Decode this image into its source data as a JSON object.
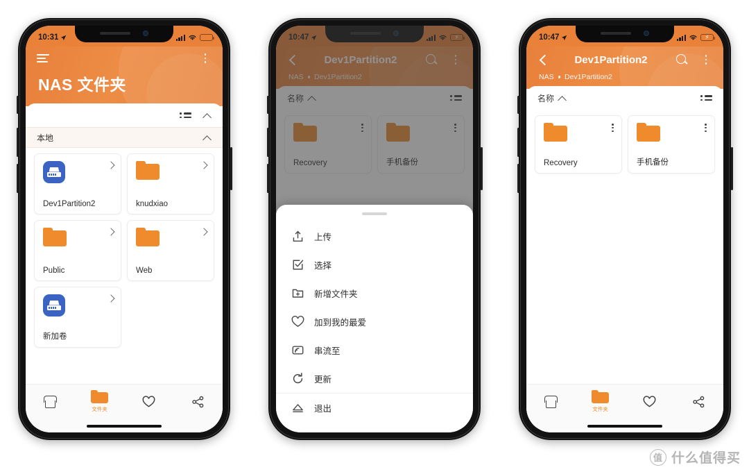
{
  "phones": [
    {
      "id": "phone-overview",
      "status": {
        "time": "10:31",
        "location_icon": "location-arrow-icon",
        "signal": "signal-bars-icon",
        "wifi": "wifi-icon",
        "battery": "battery-low-icon",
        "battery_color": "#f05a41",
        "charging": false
      },
      "header": {
        "style": "title",
        "menu_icon": "hamburger-menu-icon",
        "overflow_icon": "kebab-menu-icon",
        "title": "NAS 文件夹"
      },
      "toolbar": {
        "list_view_icon": "list-view-icon",
        "collapse_icon": "chevron-up-icon"
      },
      "group": {
        "label": "本地",
        "collapse_icon": "chevron-up-icon"
      },
      "cards": [
        {
          "name": "Dev1Partition2",
          "icon": "nas-drive-icon",
          "accessory": "chevron-right-icon"
        },
        {
          "name": "knudxiao",
          "icon": "folder-icon",
          "accessory": "chevron-right-icon"
        },
        {
          "name": "Public",
          "icon": "folder-icon",
          "accessory": "chevron-right-icon"
        },
        {
          "name": "Web",
          "icon": "folder-icon",
          "accessory": "chevron-right-icon"
        },
        {
          "name": "新加卷",
          "icon": "nas-drive-icon",
          "accessory": "chevron-right-icon"
        }
      ],
      "tabs": [
        {
          "name": "home",
          "icon": "home-icon",
          "label": "",
          "active": false
        },
        {
          "name": "files",
          "icon": "folder-icon",
          "label": "文件夹",
          "active": true
        },
        {
          "name": "favorites",
          "icon": "heart-icon",
          "label": "",
          "active": false
        },
        {
          "name": "share",
          "icon": "share-icon",
          "label": "",
          "active": false
        }
      ],
      "dimmed": false,
      "sheet": null
    },
    {
      "id": "phone-action-sheet",
      "status": {
        "time": "10:47",
        "location_icon": "location-arrow-icon",
        "signal": "signal-bars-icon",
        "wifi": "wifi-icon",
        "battery": "battery-charging-icon",
        "battery_color": "#4cd35f",
        "charging": true
      },
      "header": {
        "style": "nav",
        "back_icon": "back-chevron-icon",
        "title": "Dev1Partition2",
        "search_icon": "search-icon",
        "overflow_icon": "kebab-menu-icon",
        "breadcrumb": {
          "root": "NAS",
          "separator_icon": "breadcrumb-dot-icon",
          "current": "Dev1Partition2"
        }
      },
      "toolbar": {
        "sort_label": "名称",
        "sort_icon": "chevron-up-icon",
        "list_view_icon": "list-view-icon"
      },
      "cards": [
        {
          "name": "Recovery",
          "icon": "folder-icon",
          "accessory": "kebab-menu-icon"
        },
        {
          "name": "手机备份",
          "icon": "folder-icon",
          "accessory": "kebab-menu-icon"
        }
      ],
      "dimmed": true,
      "sheet": {
        "handle": "drag-handle",
        "items": [
          {
            "label": "上传",
            "icon": "upload-icon",
            "divided": false
          },
          {
            "label": "选择",
            "icon": "select-check-icon",
            "divided": false
          },
          {
            "label": "新增文件夹",
            "icon": "new-folder-icon",
            "divided": false
          },
          {
            "label": "加到我的最爱",
            "icon": "heart-icon",
            "divided": false
          },
          {
            "label": "串流至",
            "icon": "cast-stream-icon",
            "divided": false
          },
          {
            "label": "更新",
            "icon": "refresh-icon",
            "divided": false
          },
          {
            "label": "退出",
            "icon": "eject-icon",
            "divided": true
          }
        ]
      },
      "tabs": []
    },
    {
      "id": "phone-folder-list",
      "status": {
        "time": "10:47",
        "location_icon": "location-arrow-icon",
        "signal": "signal-bars-icon",
        "wifi": "wifi-icon",
        "battery": "battery-charging-icon",
        "battery_color": "#4cd35f",
        "charging": true
      },
      "header": {
        "style": "nav",
        "back_icon": "back-chevron-icon",
        "title": "Dev1Partition2",
        "search_icon": "search-icon",
        "overflow_icon": "kebab-menu-icon",
        "breadcrumb": {
          "root": "NAS",
          "separator_icon": "breadcrumb-dot-icon",
          "current": "Dev1Partition2"
        }
      },
      "toolbar": {
        "sort_label": "名称",
        "sort_icon": "chevron-up-icon",
        "list_view_icon": "list-view-icon"
      },
      "cards": [
        {
          "name": "Recovery",
          "icon": "folder-icon",
          "accessory": "kebab-menu-icon"
        },
        {
          "name": "手机备份",
          "icon": "folder-icon",
          "accessory": "kebab-menu-icon"
        }
      ],
      "tabs": [
        {
          "name": "home",
          "icon": "home-icon",
          "label": "",
          "active": false
        },
        {
          "name": "files",
          "icon": "folder-icon",
          "label": "文件夹",
          "active": true
        },
        {
          "name": "favorites",
          "icon": "heart-icon",
          "label": "",
          "active": false
        },
        {
          "name": "share",
          "icon": "share-icon",
          "label": "",
          "active": false
        }
      ],
      "dimmed": false,
      "sheet": null
    }
  ],
  "watermark": {
    "logo_text": "值",
    "text": "什么值得买"
  },
  "colors": {
    "accent": "#ef8b2c",
    "header_orange": "#e8803a",
    "nas_blue": "#3b63c4",
    "battery_low": "#f05a41",
    "battery_charging": "#4cd35f"
  }
}
